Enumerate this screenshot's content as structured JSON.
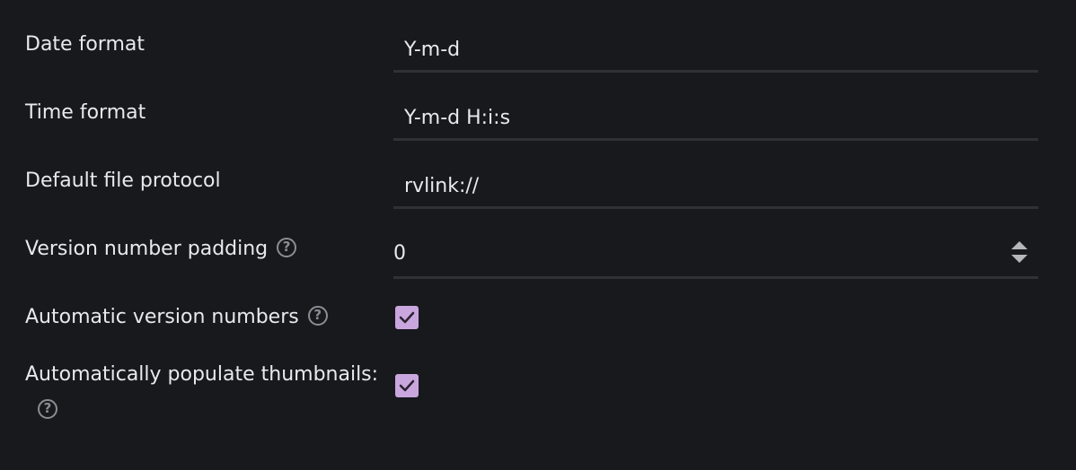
{
  "settings": {
    "date_format": {
      "label": "Date format",
      "value": "Y-m-d"
    },
    "time_format": {
      "label": "Time format",
      "value": "Y-m-d H:i:s"
    },
    "default_file_protocol": {
      "label": "Default file protocol",
      "value": "rvlink://"
    },
    "version_number_padding": {
      "label": "Version number padding",
      "value": "0",
      "has_help": true
    },
    "automatic_version_numbers": {
      "label": "Automatic version numbers",
      "checked": true,
      "has_help": true
    },
    "automatically_populate_thumbnails": {
      "label": "Automatically populate thumbnails:",
      "checked": true,
      "has_help": true
    }
  },
  "help_glyph": "?",
  "colors": {
    "background": "#17191d",
    "text": "#e8e9eb",
    "underline": "#2e3136",
    "checkbox": "#c9a6dd",
    "help_icon": "#8a8d93"
  }
}
